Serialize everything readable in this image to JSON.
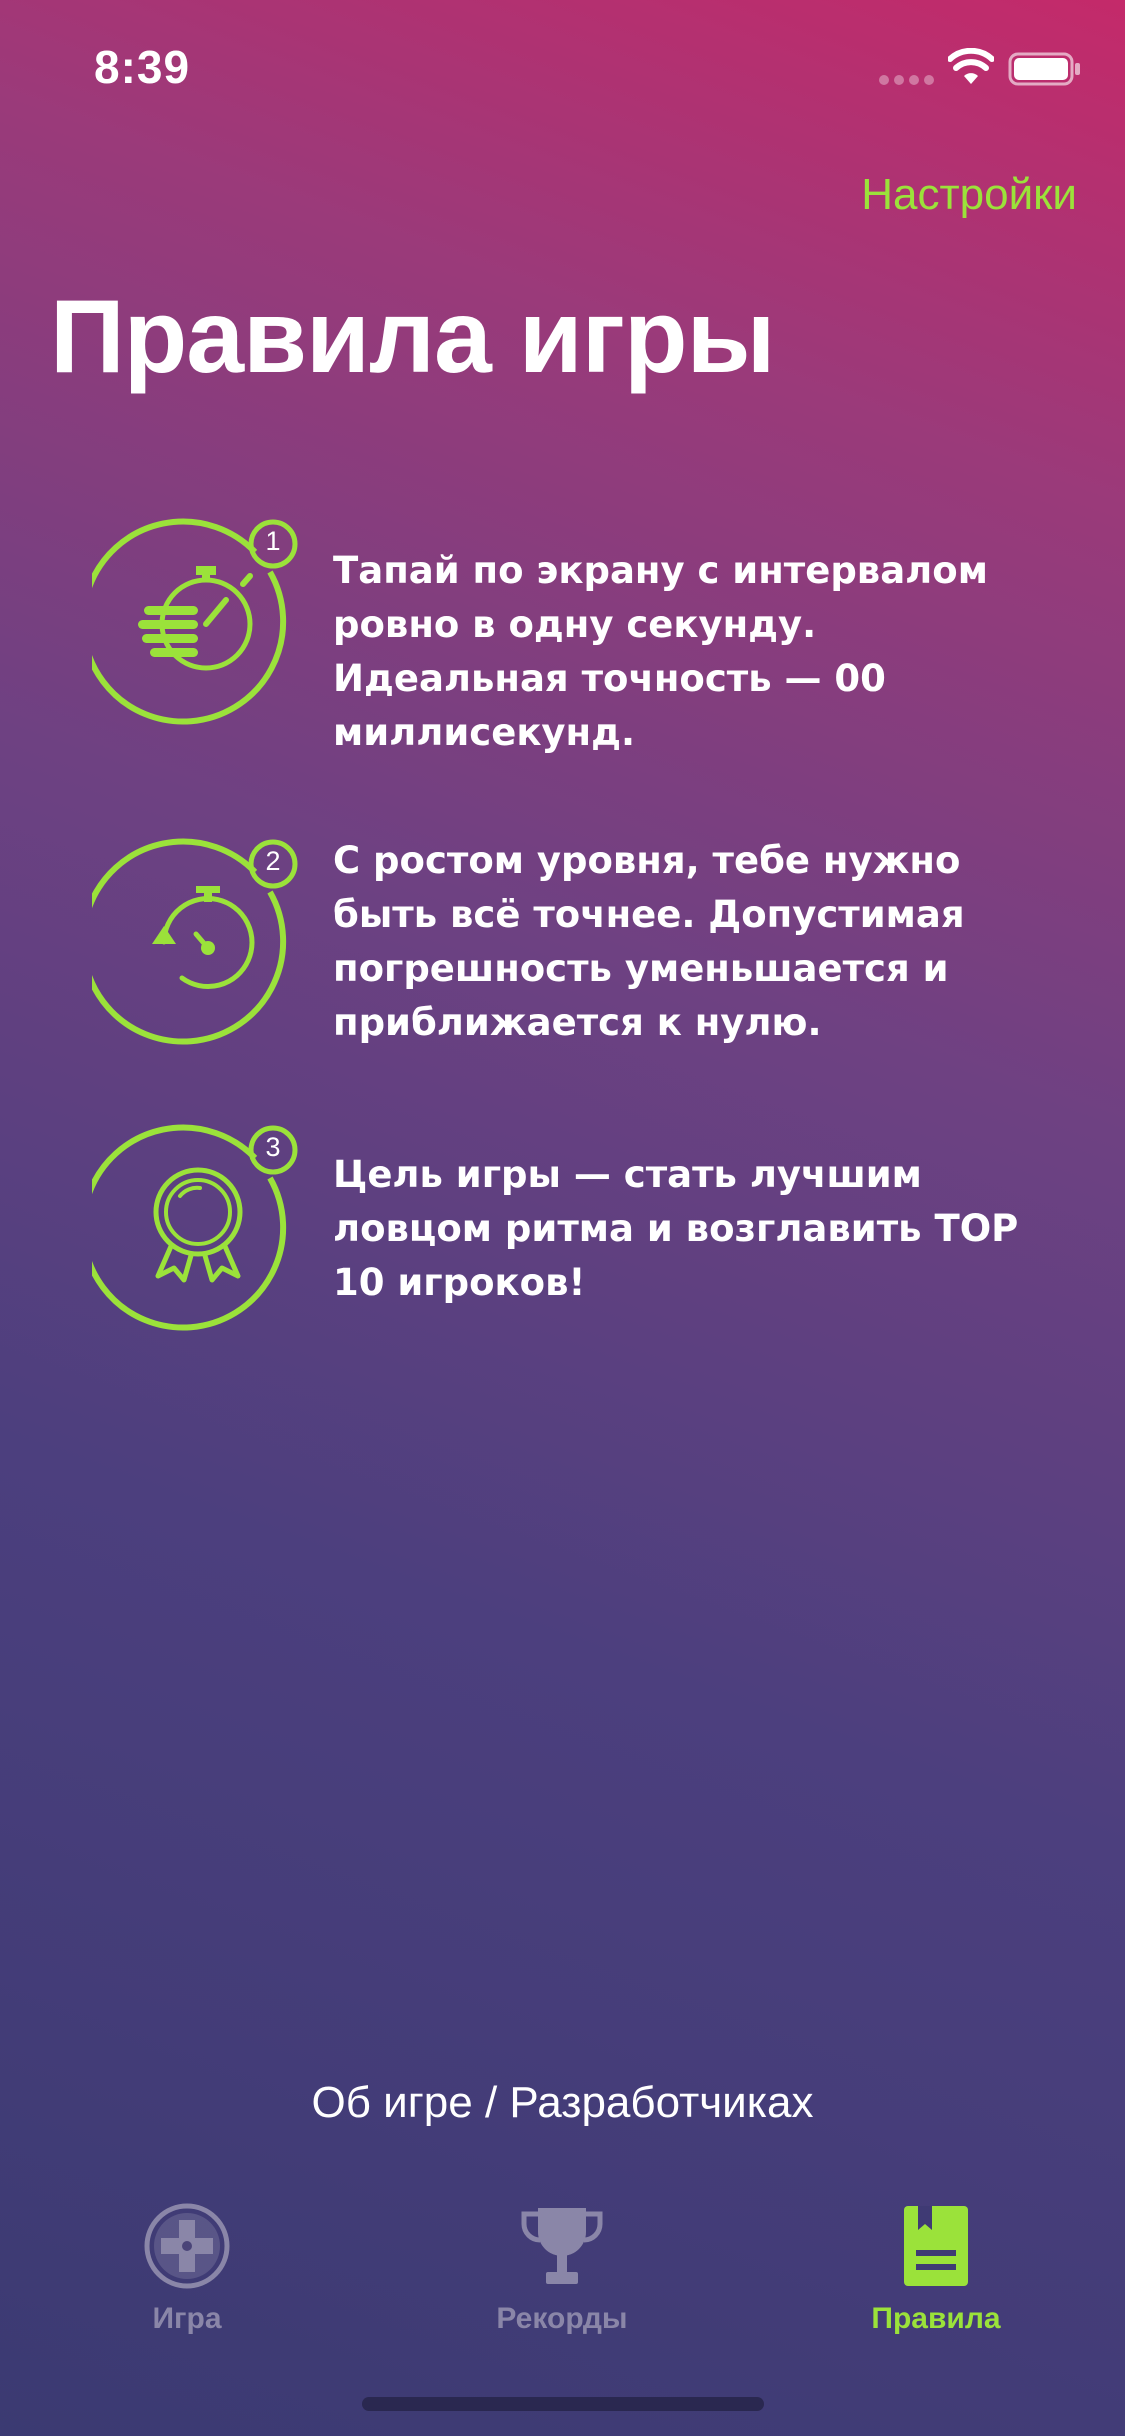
{
  "status_bar": {
    "time": "8:39"
  },
  "header": {
    "settings_label": "Настройки",
    "title": "Правила игры"
  },
  "rules": [
    {
      "number": "1",
      "icon": "hand-stopwatch-icon",
      "text": "Тапай по экрану с интервалом ровно в одну секунду. Идеальная точность — 00 миллисекунд."
    },
    {
      "number": "2",
      "icon": "timer-reset-icon",
      "text": "С ростом уровня, тебе нужно быть всё точнее. Допустимая погрешность уменьшается и приближается к нулю."
    },
    {
      "number": "3",
      "icon": "medal-icon",
      "text": "Цель игры — стать лучшим ловцом ритма и возглавить TOP 10 игроков!"
    }
  ],
  "footer": {
    "about_label": "Об игре / Разработчиках"
  },
  "tab_bar": {
    "tabs": [
      {
        "label": "Игра",
        "icon": "gamepad-icon",
        "active": false
      },
      {
        "label": "Рекорды",
        "icon": "trophy-icon",
        "active": false
      },
      {
        "label": "Правила",
        "icon": "rulebook-icon",
        "active": true
      }
    ]
  },
  "colors": {
    "accent": "#9be23a",
    "inactive_tab": "#8a86a8",
    "text": "#ffffff"
  }
}
